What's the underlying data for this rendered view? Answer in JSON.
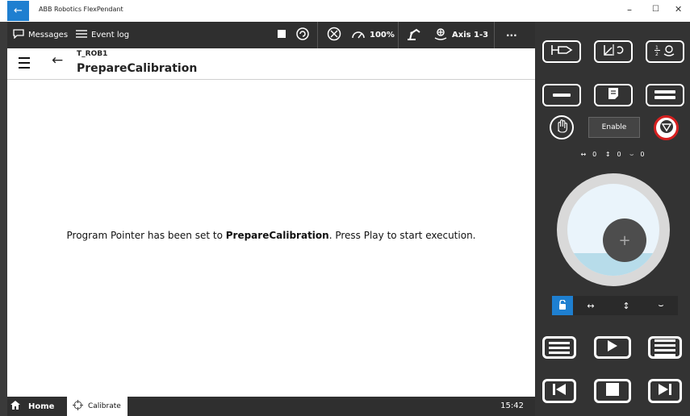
{
  "window": {
    "title": "ABB Robotics FlexPendant",
    "back_icon": "←",
    "minimize": "–",
    "maximize": "☐",
    "close": "✕"
  },
  "topbar": {
    "messages_label": "Messages",
    "event_log_label": "Event log",
    "speed": "100%",
    "axis_label": "Axis 1-3",
    "more": "···"
  },
  "header": {
    "task": "T_ROB1",
    "title": "PrepareCalibration",
    "back_icon": "←"
  },
  "main": {
    "message_prefix": "Program Pointer has been set to ",
    "message_bold": "PrepareCalibration",
    "message_suffix": ". Press Play to start execution."
  },
  "bottombar": {
    "home_label": "Home",
    "calibrate_label": "Calibrate",
    "clock": "15:42"
  },
  "panel": {
    "enable_label": "Enable",
    "axis_values": {
      "horizontal": "0",
      "vertical": "0",
      "rotate": "0"
    },
    "joystick_plus": "+",
    "accent_color": "#1e7fd0",
    "stop_ring_color": "#d62020"
  }
}
